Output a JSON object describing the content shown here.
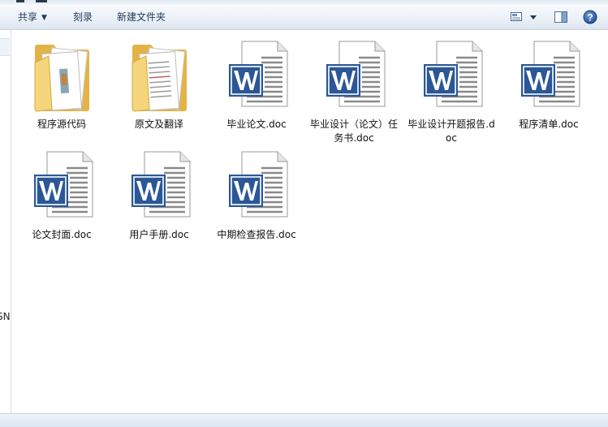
{
  "toolbar": {
    "share_label": "共享",
    "burn_label": "刻录",
    "new_folder_label": "新建文件夹",
    "view_icon": "change-view-icon",
    "preview_icon": "preview-pane-icon",
    "help_icon": "help-icon",
    "help_glyph": "?"
  },
  "nav": {
    "clipped_text": "SN"
  },
  "files": [
    {
      "name": "程序源代码",
      "type": "folder",
      "variant": "color"
    },
    {
      "name": "原文及翻译",
      "type": "folder",
      "variant": "text"
    },
    {
      "name": "毕业论文.doc",
      "type": "word"
    },
    {
      "name": "毕业设计（论文）任务书.doc",
      "type": "word"
    },
    {
      "name": "毕业设计开题报告.doc",
      "type": "word"
    },
    {
      "name": "程序清单.doc",
      "type": "word"
    },
    {
      "name": "论文封面.doc",
      "type": "word"
    },
    {
      "name": "用户手册.doc",
      "type": "word"
    },
    {
      "name": "中期检查报告.doc",
      "type": "word"
    }
  ],
  "colors": {
    "word_blue": "#2b5797",
    "folder_yellow": "#f2cf6b",
    "toolbar_text": "#1e395b"
  }
}
